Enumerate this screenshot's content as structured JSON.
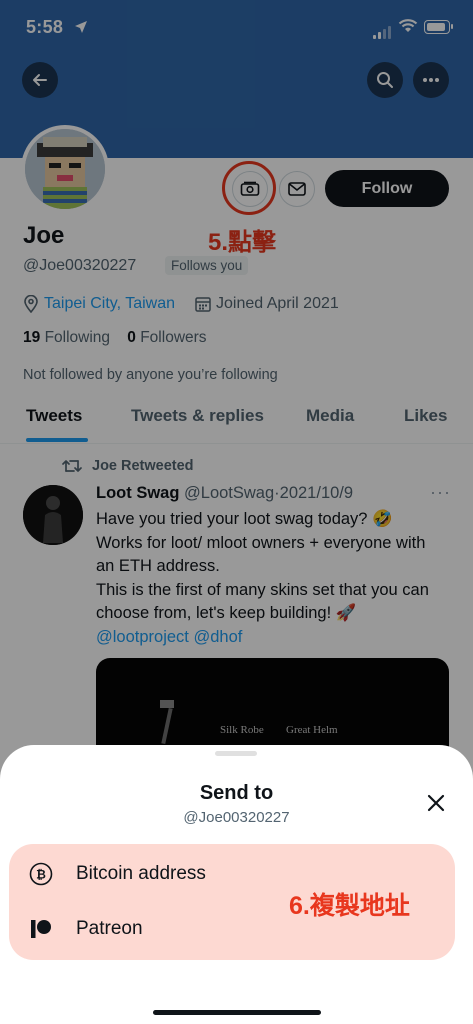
{
  "status_bar": {
    "time": "5:58"
  },
  "profile": {
    "name": "Joe",
    "handle": "@Joe00320227",
    "follows_you": "Follows you",
    "location": "Taipei City, Taiwan",
    "joined": "Joined April 2021",
    "following_count": "19",
    "following_label": "Following",
    "followers_count": "0",
    "followers_label": "Followers",
    "not_followed_text": "Not followed by anyone you’re following",
    "follow_button": "Follow"
  },
  "annotations": {
    "step5": "5.點擊",
    "step6": "6.複製地址"
  },
  "tabs": [
    {
      "label": "Tweets",
      "active": true
    },
    {
      "label": "Tweets & replies",
      "active": false
    },
    {
      "label": "Media",
      "active": false
    },
    {
      "label": "Likes",
      "active": false
    }
  ],
  "tweet": {
    "retweeted_by": "Joe Retweeted",
    "author_name": "Loot Swag",
    "author_handle": "@LootSwag",
    "separator": "·",
    "date": "2021/10/9",
    "line1": "Have you tried your loot swag today? 🤣",
    "line2": "Works for loot/ mloot owners + everyone with an ETH address.",
    "line3": "This is the first of many skins set that you can choose from, let's keep building! 🚀",
    "mention1": "@lootproject",
    "mention2": "@dhof",
    "media_caption_1": "Silk Robe",
    "media_caption_2": "Great Helm"
  },
  "sheet": {
    "title": "Send to",
    "subtitle": "@Joe00320227",
    "options": [
      {
        "label": "Bitcoin address",
        "icon": "bitcoin-icon"
      },
      {
        "label": "Patreon",
        "icon": "patreon-icon"
      }
    ]
  },
  "colors": {
    "banner": "#2f67a9",
    "accent": "#1d9bf0",
    "annotation": "#e8371e",
    "option_card": "#fdd9d2"
  }
}
